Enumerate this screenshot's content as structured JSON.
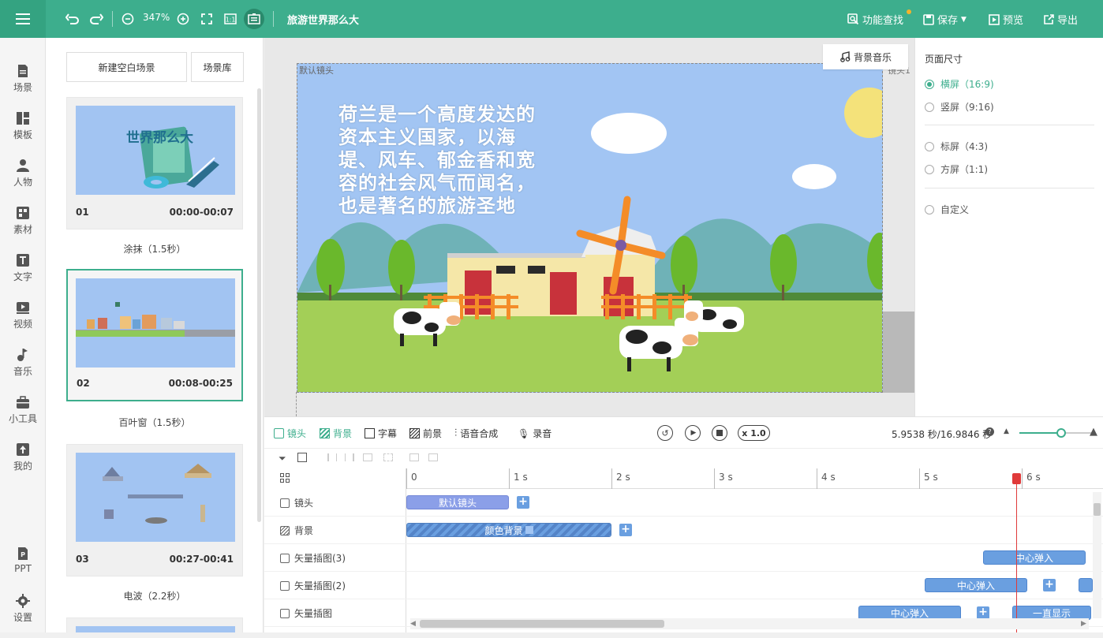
{
  "topbar": {
    "zoom": "347%",
    "project_title": "旅游世界那么大",
    "feature_search": "功能查找",
    "save": "保存",
    "preview": "预览",
    "export": "导出"
  },
  "leftnav": {
    "items": [
      {
        "label": "场景",
        "icon": "scene-icon"
      },
      {
        "label": "模板",
        "icon": "template-icon"
      },
      {
        "label": "人物",
        "icon": "person-icon"
      },
      {
        "label": "素材",
        "icon": "material-icon"
      },
      {
        "label": "文字",
        "icon": "text-icon"
      },
      {
        "label": "视频",
        "icon": "video-icon"
      },
      {
        "label": "音乐",
        "icon": "music-icon"
      },
      {
        "label": "小工具",
        "icon": "toolbox-icon"
      },
      {
        "label": "我的",
        "icon": "upload-icon"
      }
    ],
    "bottom": [
      {
        "label": "PPT",
        "icon": "ppt-icon"
      },
      {
        "label": "设置",
        "icon": "gear-icon"
      }
    ]
  },
  "scenes": {
    "new_blank": "新建空白场景",
    "library": "场景库",
    "cards": [
      {
        "num": "01",
        "time": "00:00-00:07",
        "transition": "涂抹（1.5秒）",
        "thumb_title": "世界那么大"
      },
      {
        "num": "02",
        "time": "00:08-00:25",
        "transition": "百叶窗（1.5秒）"
      },
      {
        "num": "03",
        "time": "00:27-00:41",
        "transition": "电波（2.2秒）"
      }
    ]
  },
  "canvas": {
    "camera_label": "默认镜头",
    "camera_label_right": "镜头1",
    "music_button": "背景音乐",
    "stage_text": "荷兰是一个高度发达的资本主义国家，以海堤、风车、郁金香和宽容的社会风气而闻名，也是著名的旅游圣地",
    "colors": {
      "sky": "#a2c5f3",
      "grass": "#a3cf57",
      "sun": "#f4e27a"
    }
  },
  "page_size": {
    "title": "页面尺寸",
    "options": [
      {
        "label": "横屏（16:9)",
        "selected": true
      },
      {
        "label": "竖屏（9:16)",
        "selected": false
      },
      {
        "label": "标屏（4:3)",
        "selected": false
      },
      {
        "label": "方屏（1:1)",
        "selected": false
      },
      {
        "label": "自定义",
        "selected": false
      }
    ]
  },
  "timeline": {
    "tabs": [
      {
        "label": "镜头",
        "active": true
      },
      {
        "label": "背景",
        "active": true
      },
      {
        "label": "字幕",
        "active": false
      },
      {
        "label": "前景",
        "active": false
      },
      {
        "label": "语音合成",
        "active": false
      },
      {
        "label": "录音",
        "active": false
      }
    ],
    "speed": "x 1.0",
    "time_readout": "5.9538 秒/16.9846 秒",
    "ticks": [
      "0",
      "1 s",
      "2 s",
      "3 s",
      "4 s",
      "5 s",
      "6 s"
    ],
    "rows": [
      {
        "label": "镜头"
      },
      {
        "label": "背景"
      },
      {
        "label": "矢量插图(3)"
      },
      {
        "label": "矢量插图(2)"
      },
      {
        "label": "矢量插图"
      }
    ],
    "clips": {
      "camera": "默认镜头",
      "background": "颜色背景",
      "vec3": "中心弹入",
      "vec2": "中心弹入",
      "vec1a": "中心弹入",
      "vec1b": "一直显示"
    }
  }
}
